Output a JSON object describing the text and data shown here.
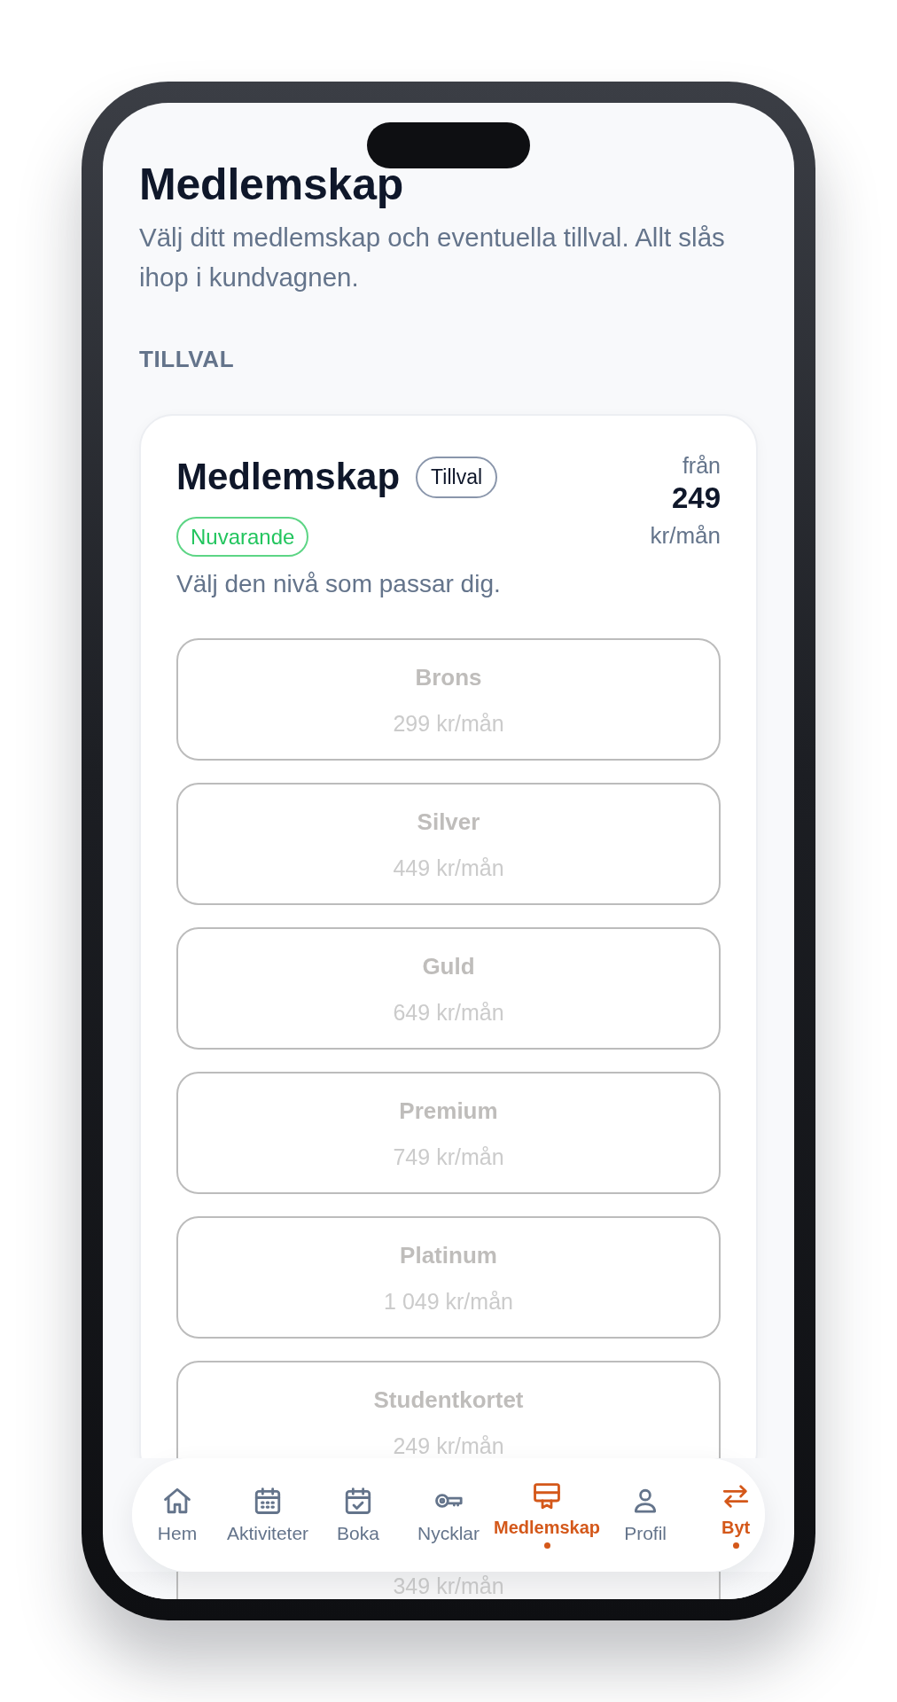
{
  "page": {
    "title": "Medlemskap",
    "intro": "Välj ditt medlemskap och eventuella tillval. Allt slås ihop i kundvagnen."
  },
  "section": {
    "heading": "TILLVAL"
  },
  "product": {
    "title": "Medlemskap",
    "tag": "Tillval",
    "status": "Nuvarande",
    "description": "Välj den nivå som passar dig.",
    "price_prefix": "från",
    "price": "249",
    "price_unit": "kr/mån",
    "tiers": [
      {
        "name": "Brons",
        "price": "299 kr/mån",
        "disabled": true
      },
      {
        "name": "Silver",
        "price": "449 kr/mån",
        "disabled": true
      },
      {
        "name": "Guld",
        "price": "649 kr/mån",
        "disabled": true
      },
      {
        "name": "Premium",
        "price": "749 kr/mån",
        "disabled": true
      },
      {
        "name": "Platinum",
        "price": "1 049 kr/mån",
        "disabled": true
      },
      {
        "name": "Studentkortet",
        "price": "249 kr/mån",
        "disabled": true
      },
      {
        "price": "349 kr/mån",
        "disabled": true
      }
    ]
  },
  "nav": [
    {
      "label": "Hem",
      "selected": false
    },
    {
      "label": "Aktiviteter",
      "selected": false
    },
    {
      "label": "Boka",
      "selected": false
    },
    {
      "label": "Nycklar",
      "selected": false
    },
    {
      "label": "Medlemskap",
      "selected": true
    },
    {
      "label": "Profil",
      "selected": false
    },
    {
      "label": "Byt",
      "selected": true
    }
  ]
}
